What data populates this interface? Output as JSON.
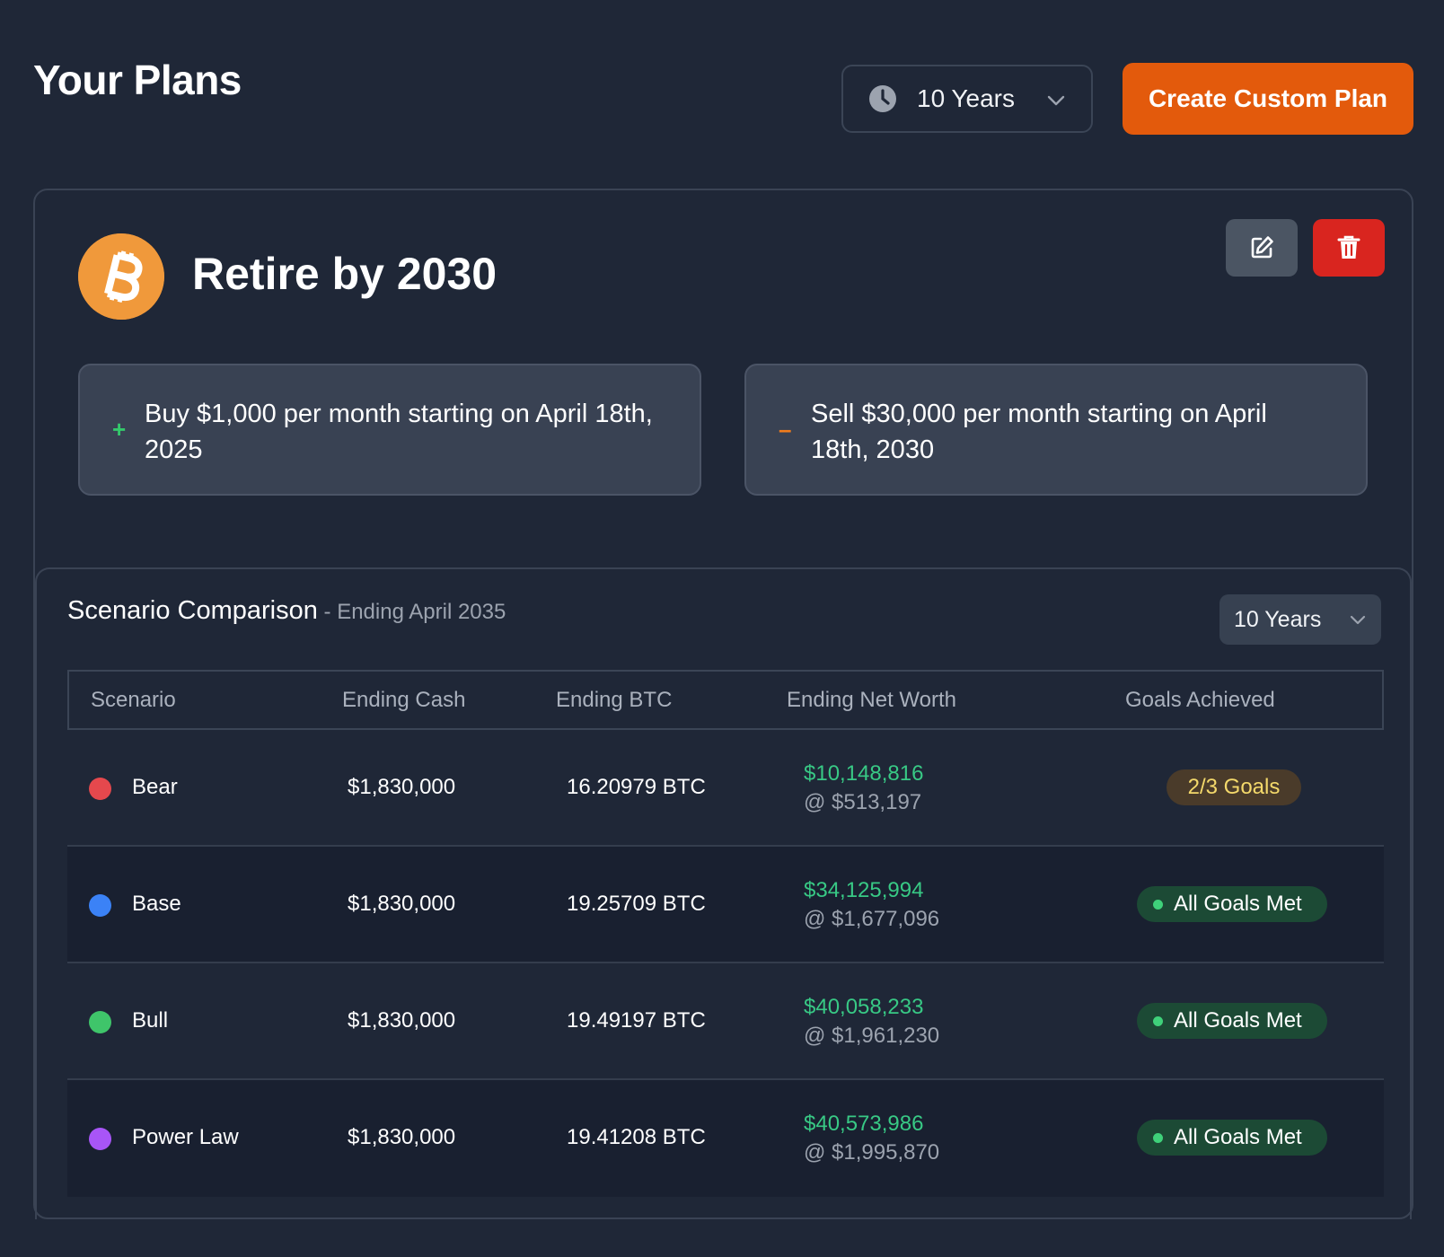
{
  "header": {
    "title": "Your Plans",
    "time_range": "10 Years",
    "create_button": "Create Custom Plan"
  },
  "plan": {
    "title": "Retire by 2030",
    "buy_sign": "+",
    "buy_text": "Buy $1,000 per month starting on April 18th, 2025",
    "sell_sign": "–",
    "sell_text": "Sell $30,000 per month starting on April 18th, 2030"
  },
  "comparison": {
    "title": "Scenario Comparison",
    "subtitle": " - Ending April 2035",
    "time_range": "10 Years",
    "columns": {
      "scenario": "Scenario",
      "cash": "Ending Cash",
      "btc": "Ending BTC",
      "net_worth": "Ending Net Worth",
      "goals": "Goals Achieved"
    },
    "rows": [
      {
        "name": "Bear",
        "color": "#e5484d",
        "cash": "$1,830,000",
        "btc": "16.20979 BTC",
        "net_worth": "$10,148,816",
        "price": "@ $513,197",
        "goals": "2/3 Goals",
        "all_met": false
      },
      {
        "name": "Base",
        "color": "#3b82f6",
        "cash": "$1,830,000",
        "btc": "19.25709 BTC",
        "net_worth": "$34,125,994",
        "price": "@ $1,677,096",
        "goals": "All Goals Met",
        "all_met": true
      },
      {
        "name": "Bull",
        "color": "#3fc56a",
        "cash": "$1,830,000",
        "btc": "19.49197 BTC",
        "net_worth": "$40,058,233",
        "price": "@ $1,961,230",
        "goals": "All Goals Met",
        "all_met": true
      },
      {
        "name": "Power Law",
        "color": "#a855f7",
        "cash": "$1,830,000",
        "btc": "19.41208 BTC",
        "net_worth": "$40,573,986",
        "price": "@ $1,995,870",
        "goals": "All Goals Met",
        "all_met": true
      }
    ]
  },
  "icons": {
    "clock": "clock-icon",
    "chevron": "chevron-down-icon",
    "edit": "edit-icon",
    "delete": "trash-icon",
    "logo": "bitcoin-icon"
  }
}
